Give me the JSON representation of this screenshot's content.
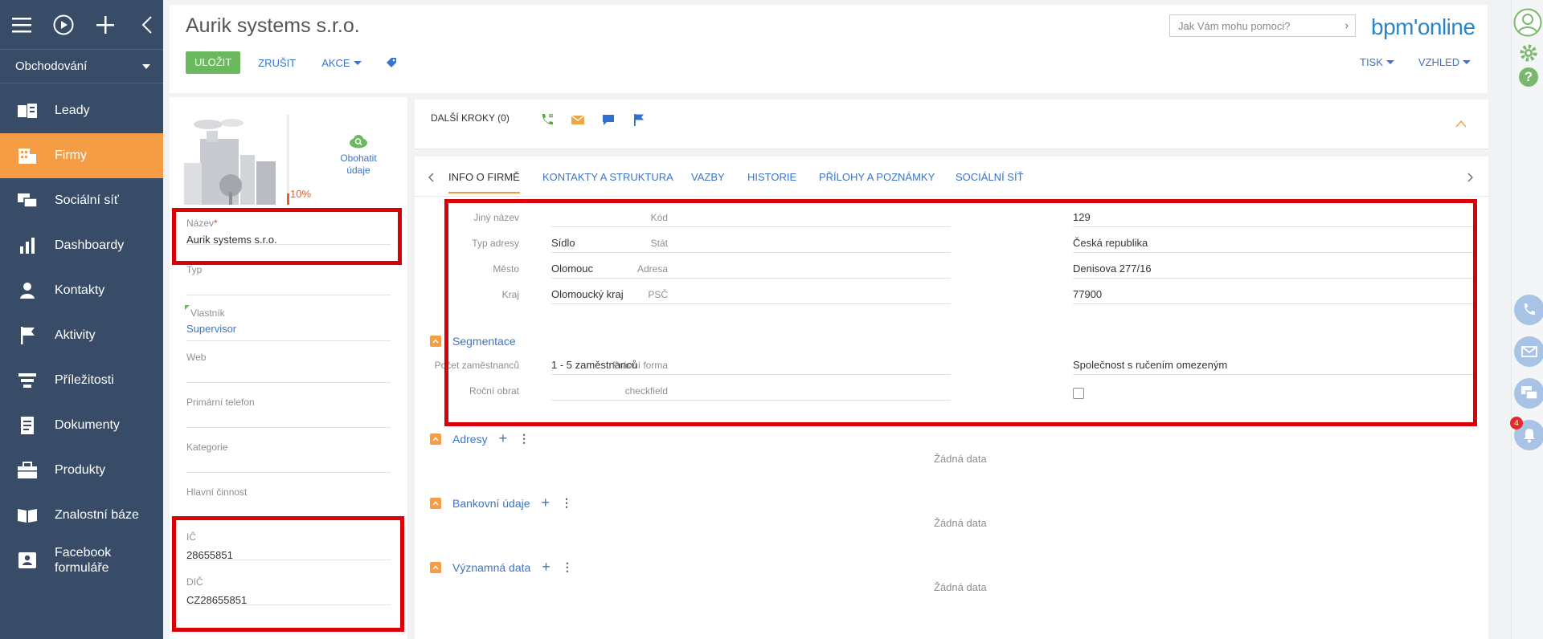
{
  "left_nav": {
    "section": "Obchodování",
    "items": [
      {
        "label": "Leady",
        "icon": "leads-icon",
        "active": false
      },
      {
        "label": "Firmy",
        "icon": "accounts-icon",
        "active": true
      },
      {
        "label": "Sociální síť",
        "icon": "social-network-icon",
        "active": false
      },
      {
        "label": "Dashboardy",
        "icon": "dashboard-icon",
        "active": false
      },
      {
        "label": "Kontakty",
        "icon": "contact-icon",
        "active": false
      },
      {
        "label": "Aktivity",
        "icon": "flag-icon",
        "active": false
      },
      {
        "label": "Příležitosti",
        "icon": "funnel-icon",
        "active": false
      },
      {
        "label": "Dokumenty",
        "icon": "document-icon",
        "active": false
      },
      {
        "label": "Produkty",
        "icon": "products-icon",
        "active": false
      },
      {
        "label": "Znalostní báze",
        "icon": "book-icon",
        "active": false
      },
      {
        "label": "Facebook formuláře",
        "icon": "facebook-form-icon",
        "active": false
      }
    ]
  },
  "header": {
    "title": "Aurik systems s.r.o.",
    "save_label": "ULOŽIT",
    "cancel_label": "ZRUŠIT",
    "actions_label": "AKCE",
    "search_placeholder": "Jak Vám mohu pomoci?",
    "brand": "bpm'online",
    "print_label": "TISK",
    "view_label": "VZHLED"
  },
  "profile": {
    "enrich_label": "Obohatit údaje",
    "completeness": "10%",
    "name_label": "Název",
    "name_value": "Aurik systems s.r.o.",
    "type_label": "Typ",
    "owner_label": "Vlastník",
    "owner_value": "Supervisor",
    "web_label": "Web",
    "phone_label": "Primární telefon",
    "category_label": "Kategorie",
    "activity_label": "Hlavní činnost",
    "ic_label": "IČ",
    "ic_value": "28655851",
    "dic_label": "DIČ",
    "dic_value": "CZ28655851"
  },
  "next_steps": {
    "title": "DALŠÍ KROKY (0)"
  },
  "tabs": [
    "INFO O FIRMĚ",
    "KONTAKTY A STRUKTURA",
    "VAZBY",
    "HISTORIE",
    "PŘÍLOHY A POZNÁMKY",
    "SOCIÁLNÍ SÍŤ"
  ],
  "info": {
    "left": [
      {
        "label": "Jiný název",
        "value": ""
      },
      {
        "label": "Typ adresy",
        "value": "Sídlo"
      },
      {
        "label": "Město",
        "value": "Olomouc"
      },
      {
        "label": "Kraj",
        "value": "Olomoucký kraj"
      }
    ],
    "right": [
      {
        "label": "Kód",
        "value": "129"
      },
      {
        "label": "Stát",
        "value": "Česká republika"
      },
      {
        "label": "Adresa",
        "value": "Denisova 277/16"
      },
      {
        "label": "PSČ",
        "value": "77900"
      }
    ],
    "segmentation_title": "Segmentace",
    "employees_label": "Počet zaměstnanců",
    "employees_value": "1 - 5 zaměstnanců",
    "legal_form_label": "Právní forma",
    "legal_form_value": "Společnost s ručením omezeným",
    "turnover_label": "Roční obrat",
    "turnover_value": "",
    "checkfield_label": "checkfield"
  },
  "detail_groups": [
    {
      "title": "Adresy",
      "empty": "Žádná data"
    },
    {
      "title": "Bankovní údaje",
      "empty": "Žádná data"
    },
    {
      "title": "Významná data",
      "empty": "Žádná data"
    }
  ],
  "notifications_count": "4",
  "colors": {
    "nav_bg": "#384b67",
    "nav_active": "#f59d45",
    "save_green": "#6cb85e",
    "link_blue": "#3b74c7",
    "highlight_red": "#d90008"
  }
}
